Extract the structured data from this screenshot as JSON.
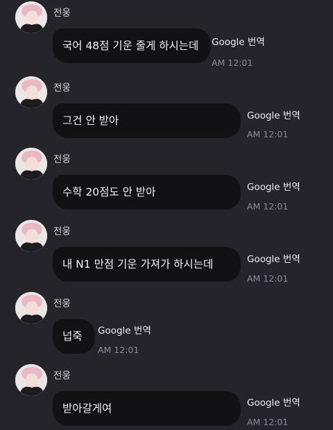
{
  "chat": {
    "messages": [
      {
        "sender": "전웅",
        "text": "국어 48점 기운 줄게 하시는데",
        "translate_label": "Google 번역",
        "time": "AM 12:01"
      },
      {
        "sender": "전웅",
        "text": "그건 안 받아",
        "translate_label": "Google 번역",
        "time": "AM 12:01"
      },
      {
        "sender": "전웅",
        "text": "수학 20점도 안 받아",
        "translate_label": "Google 번역",
        "time": "AM 12:01"
      },
      {
        "sender": "전웅",
        "text": "내 N1 만점 기운 가져가 하시는데",
        "translate_label": "Google 번역",
        "time": "AM 12:01"
      },
      {
        "sender": "전웅",
        "text": "넙죽",
        "translate_label": "Google 번역",
        "time": "AM 12:01"
      },
      {
        "sender": "전웅",
        "text": "받아갈게여",
        "translate_label": "Google 번역",
        "time": "AM 12:01"
      }
    ]
  }
}
